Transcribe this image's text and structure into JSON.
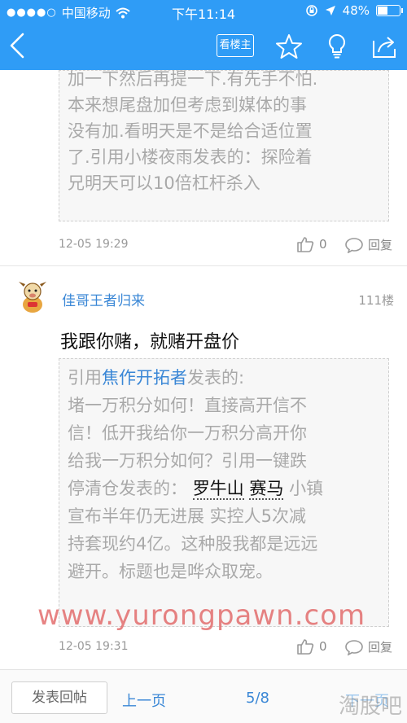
{
  "status_bar": {
    "signal": "●●●●○",
    "carrier": "中国移动",
    "time": "下午11:14",
    "battery": "48%"
  },
  "nav": {
    "view_op_label": "看楼主"
  },
  "post1": {
    "quote_lines": [
      "加一下然后再提一下.有先手不怕.",
      "本来想尾盘加但考虑到媒体的事",
      "没有加.看明天是不是给合适位置",
      "了.引用小楼夜雨发表的：探险着",
      "兄明天可以10倍杠杆杀入"
    ],
    "date": "12-05 19:29",
    "likes": "0",
    "reply_label": "回复"
  },
  "post2": {
    "username": "佳哥王者归来",
    "floor": "111楼",
    "text": "我跟你赌，就赌开盘价",
    "quote": {
      "prefix": "引用",
      "quoted_user": "焦作开拓者",
      "suffix": "发表的:",
      "line2": "堵一万积分如何！直接高开信不",
      "line3": "信！低开我给你一万积分高开你",
      "line4": "给我一万积分如何？引用一键跌",
      "line5_pre": "停清仓发表的：",
      "link1": "罗牛山",
      "link2": "赛马",
      "line5_post": "小镇",
      "line6": "宣布半年仍无进展 实控人5次减",
      "line7": "持套现约4亿。这种股我都是远远",
      "line8": "避开。标题也是哗众取宠。"
    },
    "date": "12-05 19:31",
    "likes": "0",
    "reply_label": "回复"
  },
  "watermark": "www.yurongpawn.com",
  "bottom": {
    "post_reply": "发表回帖",
    "prev": "上一页",
    "page": "5/8",
    "next": "下一页",
    "corner_watermark": "淘股吧"
  },
  "colors": {
    "nav_blue": "#2f9cf6",
    "link_blue": "#3a87d6",
    "watermark_red": "#e05a5a"
  }
}
